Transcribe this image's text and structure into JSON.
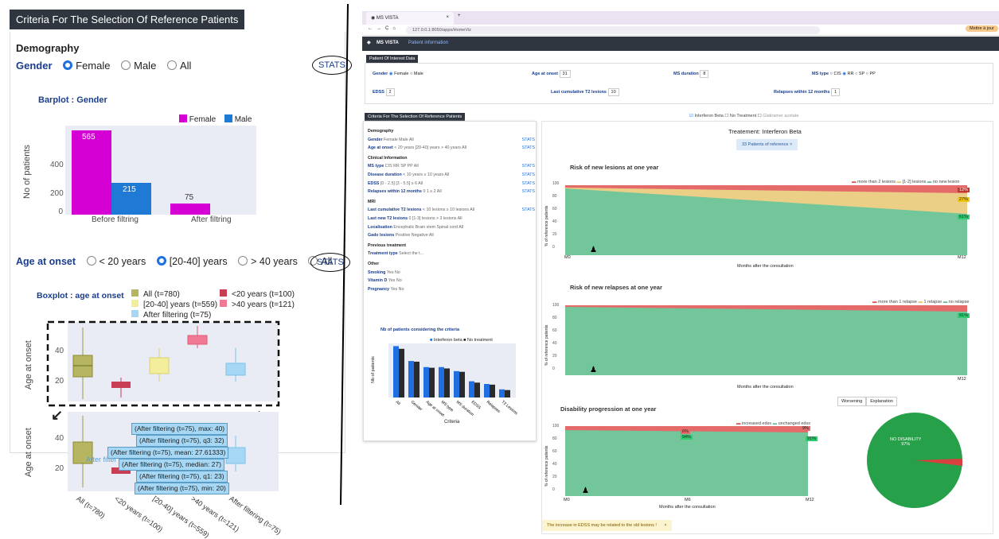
{
  "left_panel": {
    "title": "Criteria For The Selection Of Reference Patients",
    "demography": "Demography",
    "gender_label": "Gender",
    "gender_options": [
      "Female",
      "Male",
      "All"
    ],
    "stats": "STATS",
    "barplot_title": "Barplot : Gender",
    "legend_female": "Female",
    "legend_male": "Male",
    "ylabel": "No of patients",
    "yticks": [
      "400",
      "200",
      "0"
    ],
    "categories": [
      "Before filtring",
      "After filtring"
    ],
    "bar_labels": [
      "565",
      "215",
      "75"
    ],
    "age_label": "Age at onset",
    "age_options": [
      "< 20 years",
      "[20-40] years",
      "> 40 years",
      "All"
    ],
    "boxplot_title": "Boxplot : age at onset",
    "box_legend": [
      "All (t=780)",
      "<20 years (t=100)",
      "[20-40] years (t=559)",
      ">40 years (t=121)",
      "After filtering (t=75)"
    ],
    "box_ylabel": "Age at onset",
    "box_yticks": [
      "40",
      "20"
    ],
    "tooltips": [
      "(After filtering (t=75), max: 40)",
      "(After filtering (t=75), q3: 32)",
      "(After filtering (t=75), mean: 27.61333)",
      "(After filtering (t=75), median: 27)",
      "(After filtering (t=75), q1: 23)",
      "(After filtering (t=75), min: 20)"
    ],
    "after_filter_tag": "After filter",
    "box_xticks": [
      "All (t=780)",
      "<20 years (t=100)",
      "[20-40] years (t=559)",
      ">40 years (t=121)",
      "After filtering (t=75)"
    ]
  },
  "browser": {
    "tab_title": "MS VISTA",
    "url": "127.0.0.1:8050/apps/HomeViz",
    "profile": "Mettre à jour",
    "app_name": "MS VISTA",
    "nav_link": "Patient information"
  },
  "poi": {
    "title": "Patient Of Interest Data",
    "gender": "Gender",
    "gender_opts": [
      "Female",
      "Male"
    ],
    "age": "Age at onset",
    "age_val": "31",
    "duration": "MS duration",
    "duration_val": "8",
    "mstype": "MS type",
    "mstype_opts": [
      "CIS",
      "RR",
      "SP",
      "PP"
    ],
    "edss": "EDSS",
    "edss_val": "2",
    "t2": "Last cumulative T2 lesions",
    "t2_val": "10",
    "relapses": "Relapses within 12 months",
    "relapses_val": "1"
  },
  "treatments": [
    "Interferon Beta",
    "No Treatment",
    "Glatiramer acetate"
  ],
  "criteria": {
    "title": "Criteria For The Selection Of Reference Patients",
    "rows": [
      {
        "h": "Demography"
      },
      {
        "l": "Gender",
        "o": "Female   Male   All",
        "s": "STATS"
      },
      {
        "l": "Age at onset",
        "o": "< 20 years   [20-40] years   > 40 years   All",
        "s": "STATS"
      },
      {
        "h": "Clinical Information"
      },
      {
        "l": "MS type",
        "o": "CIS   RR   SP   PP   All",
        "s": "STATS"
      },
      {
        "l": "Disease duration",
        "o": "< 10 years   ≥ 10 years   All",
        "s": "STATS"
      },
      {
        "l": "EDSS",
        "o": "[0 - 2.5]   [3 - 5.5]   ≥ 6   All",
        "s": "STATS"
      },
      {
        "l": "Relapses within 12 months",
        "o": "0   1   ≥ 2   All",
        "s": "STATS"
      },
      {
        "h": "MRI"
      },
      {
        "l": "Last cumulative T2 lesions",
        "o": "< 10 lesions   ≥ 10 lesions   All",
        "s": "STATS"
      },
      {
        "l": "Last new T2 lesions",
        "o": "0   [1-3] lesions   > 3 lesions   All",
        "s": ""
      },
      {
        "l": "Localisation",
        "o": "Encephalic   Brain stem   Spinal cord   All",
        "s": ""
      },
      {
        "l": "Gado lesions",
        "o": "Positive   Negative   All",
        "s": ""
      },
      {
        "h": "Previous treatment"
      },
      {
        "l": "Treatment type",
        "o": "Select the t...",
        "s": ""
      },
      {
        "h": "Other"
      },
      {
        "l": "Smoking",
        "o": "Yes   No",
        "s": ""
      },
      {
        "l": "Vitamin D",
        "o": "Yes   No",
        "s": ""
      },
      {
        "l": "Pregnancy",
        "o": "Yes   No",
        "s": ""
      }
    ],
    "mini_title": "Nb of patients considering the criteria",
    "mini_legend": [
      "Interferon beta",
      "No treatment"
    ],
    "mini_ylabel": "Nb of patients",
    "mini_xlabel": "Criteria",
    "mini_cats": [
      "All",
      "Gender",
      "Age at onset",
      "MS type",
      "MS duration",
      "EDSS",
      "Relapses",
      "T2 Lesions"
    ]
  },
  "main": {
    "title": "Treatement: Interferon Beta",
    "badge": "33 Patients of reference",
    "c1_title": "Risk of new lesions at one year",
    "c1_legend": [
      "more than 2 lesions",
      "[1-2] lesions",
      "no new lesion"
    ],
    "c1_labels": [
      "12%",
      "27%",
      "61%"
    ],
    "c2_title": "Risk of new relapses at one year",
    "c2_legend": [
      "more than 1 relapse",
      "1 relapse",
      "no relapse"
    ],
    "c2_labels": [
      "91%"
    ],
    "c3_title": "Disability progression at one year",
    "c3_legend": [
      "increased edss",
      "unchanged edss"
    ],
    "c3_labels": [
      "6%",
      "94%",
      "9%",
      "91%"
    ],
    "ylabel": "% of reference patients",
    "xlabel": "Months after the consultation",
    "yticks": [
      "100",
      "80",
      "60",
      "40",
      "20",
      "0"
    ],
    "x_m0": "M0",
    "x_m6": "M6",
    "x_m12": "M12",
    "tabs": [
      "Worsening",
      "Explanation"
    ],
    "pie_label": "NO DISABILITY",
    "pie_value": "97%",
    "toast": "The increase in EDSS may be related to the old lesions !"
  }
}
